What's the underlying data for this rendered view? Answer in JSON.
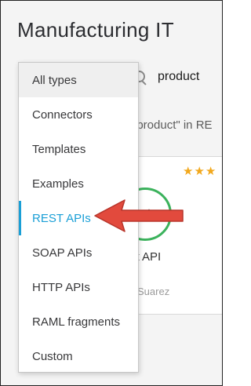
{
  "page": {
    "title": "Manufacturing IT"
  },
  "search": {
    "icon": "search-icon",
    "value": "product",
    "results_summary": "\"product\" in RE"
  },
  "card": {
    "rating": "★★★",
    "name": "ct API",
    "author": "Suarez",
    "icon_color": "#3bb25c"
  },
  "type_filter": {
    "items": [
      {
        "label": "All types"
      },
      {
        "label": "Connectors"
      },
      {
        "label": "Templates"
      },
      {
        "label": "Examples"
      },
      {
        "label": "REST APIs"
      },
      {
        "label": "SOAP APIs"
      },
      {
        "label": "HTTP APIs"
      },
      {
        "label": "RAML fragments"
      },
      {
        "label": "Custom"
      }
    ],
    "selected_index": 0,
    "highlighted_index": 4,
    "highlight_color": "#1a9fd6"
  },
  "annotation": {
    "icon": "arrow-left-icon",
    "color": "#e24a3d"
  }
}
